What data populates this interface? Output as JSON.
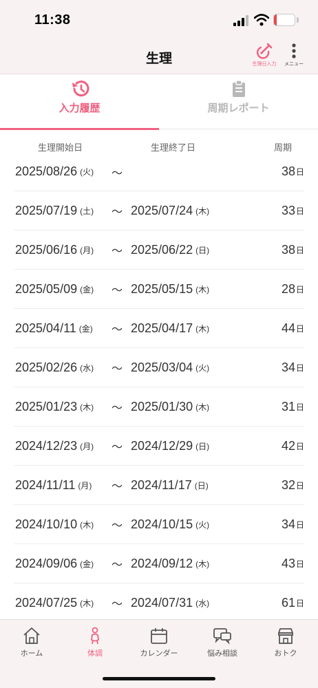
{
  "status_bar": {
    "time": "11:38",
    "battery_level": "14",
    "battery_fraction": 0.14,
    "icons": [
      "cellular-signal-icon",
      "wifi-icon",
      "battery-icon"
    ]
  },
  "header": {
    "title": "生理",
    "entry_button_label": "生理日入力",
    "menu_button_label": "メニュー"
  },
  "tabs": [
    {
      "label": "入力履歴",
      "icon": "history-icon",
      "active": true
    },
    {
      "label": "周期レポート",
      "icon": "clipboard-icon",
      "active": false
    }
  ],
  "columns": {
    "start": "生理開始日",
    "end": "生理終了日",
    "cycle": "周期"
  },
  "history": [
    {
      "start": "2025/08/26",
      "start_dow": "(火)",
      "end": "",
      "end_dow": "",
      "cycle": "38"
    },
    {
      "start": "2025/07/19",
      "start_dow": "(土)",
      "end": "2025/07/24",
      "end_dow": "(木)",
      "cycle": "33"
    },
    {
      "start": "2025/06/16",
      "start_dow": "(月)",
      "end": "2025/06/22",
      "end_dow": "(日)",
      "cycle": "38"
    },
    {
      "start": "2025/05/09",
      "start_dow": "(金)",
      "end": "2025/05/15",
      "end_dow": "(木)",
      "cycle": "28"
    },
    {
      "start": "2025/04/11",
      "start_dow": "(金)",
      "end": "2025/04/17",
      "end_dow": "(木)",
      "cycle": "44"
    },
    {
      "start": "2025/02/26",
      "start_dow": "(水)",
      "end": "2025/03/04",
      "end_dow": "(火)",
      "cycle": "34"
    },
    {
      "start": "2025/01/23",
      "start_dow": "(木)",
      "end": "2025/01/30",
      "end_dow": "(木)",
      "cycle": "31"
    },
    {
      "start": "2024/12/23",
      "start_dow": "(月)",
      "end": "2024/12/29",
      "end_dow": "(日)",
      "cycle": "42"
    },
    {
      "start": "2024/11/11",
      "start_dow": "(月)",
      "end": "2024/11/17",
      "end_dow": "(日)",
      "cycle": "32"
    },
    {
      "start": "2024/10/10",
      "start_dow": "(木)",
      "end": "2024/10/15",
      "end_dow": "(火)",
      "cycle": "34"
    },
    {
      "start": "2024/09/06",
      "start_dow": "(金)",
      "end": "2024/09/12",
      "end_dow": "(木)",
      "cycle": "43"
    },
    {
      "start": "2024/07/25",
      "start_dow": "(木)",
      "end": "2024/07/31",
      "end_dow": "(水)",
      "cycle": "61"
    }
  ],
  "range_separator": "〜",
  "cycle_unit": "日",
  "bottom_nav": [
    {
      "label": "ホーム",
      "icon": "home-icon",
      "active": false
    },
    {
      "label": "体調",
      "icon": "body-icon",
      "active": true
    },
    {
      "label": "カレンダー",
      "icon": "calendar-icon",
      "active": false
    },
    {
      "label": "悩み相談",
      "icon": "chat-icon",
      "active": false
    },
    {
      "label": "おトク",
      "icon": "shop-icon",
      "active": false
    }
  ],
  "colors": {
    "accent": "#f0607f",
    "header_bg": "#f8f2f3",
    "inactive_tab": "#b8b8b8",
    "battery_low": "#e5484d"
  }
}
